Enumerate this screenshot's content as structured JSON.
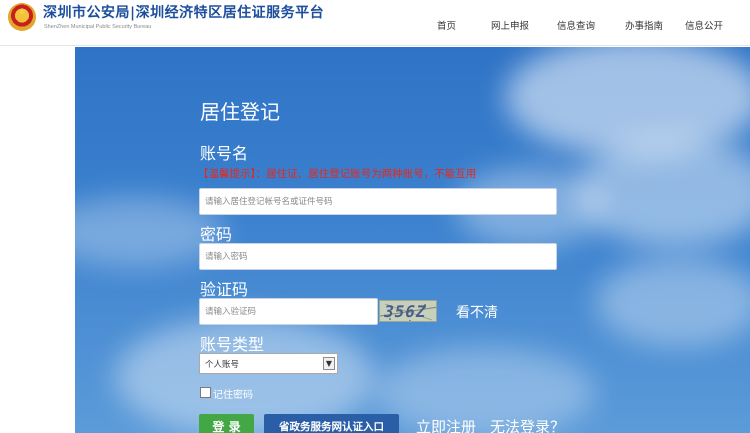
{
  "header": {
    "title": "深圳市公安局|深圳经济特区居住证服务平台",
    "subtitle": "ShenZhen Municipal Public Security Bureau",
    "nav": [
      "首页",
      "网上申报",
      "信息查询",
      "办事指南",
      "信息公开"
    ]
  },
  "form": {
    "title": "居住登记",
    "account_label": "账号名",
    "tip": "【温馨提示】：居住证、居住登记账号为两种账号，不能互用",
    "account_placeholder": "请输入居住登记帐号名或证件号码",
    "password_label": "密码",
    "password_placeholder": "请输入密码",
    "captcha_label": "验证码",
    "captcha_placeholder": "请输入验证码",
    "captcha_text": "356Z",
    "refresh_label": "看不清",
    "account_type_label": "账号类型",
    "account_type_selected": "个人账号",
    "remember_label": "记住密码",
    "login_button": "登 录",
    "gov_button": "省政务服务网认证入口",
    "register_link": "立即注册",
    "cannot_login_link": "无法登录？"
  },
  "icons": {
    "emblem": "police-emblem-icon",
    "select_arrow": "chevron-down-icon"
  },
  "colors": {
    "brand_blue": "#1b4e9c",
    "tip_red": "#e8261b",
    "login_green": "#41a845",
    "gov_blue": "#2a5ea7",
    "sky_blue": "#3c82cf"
  }
}
